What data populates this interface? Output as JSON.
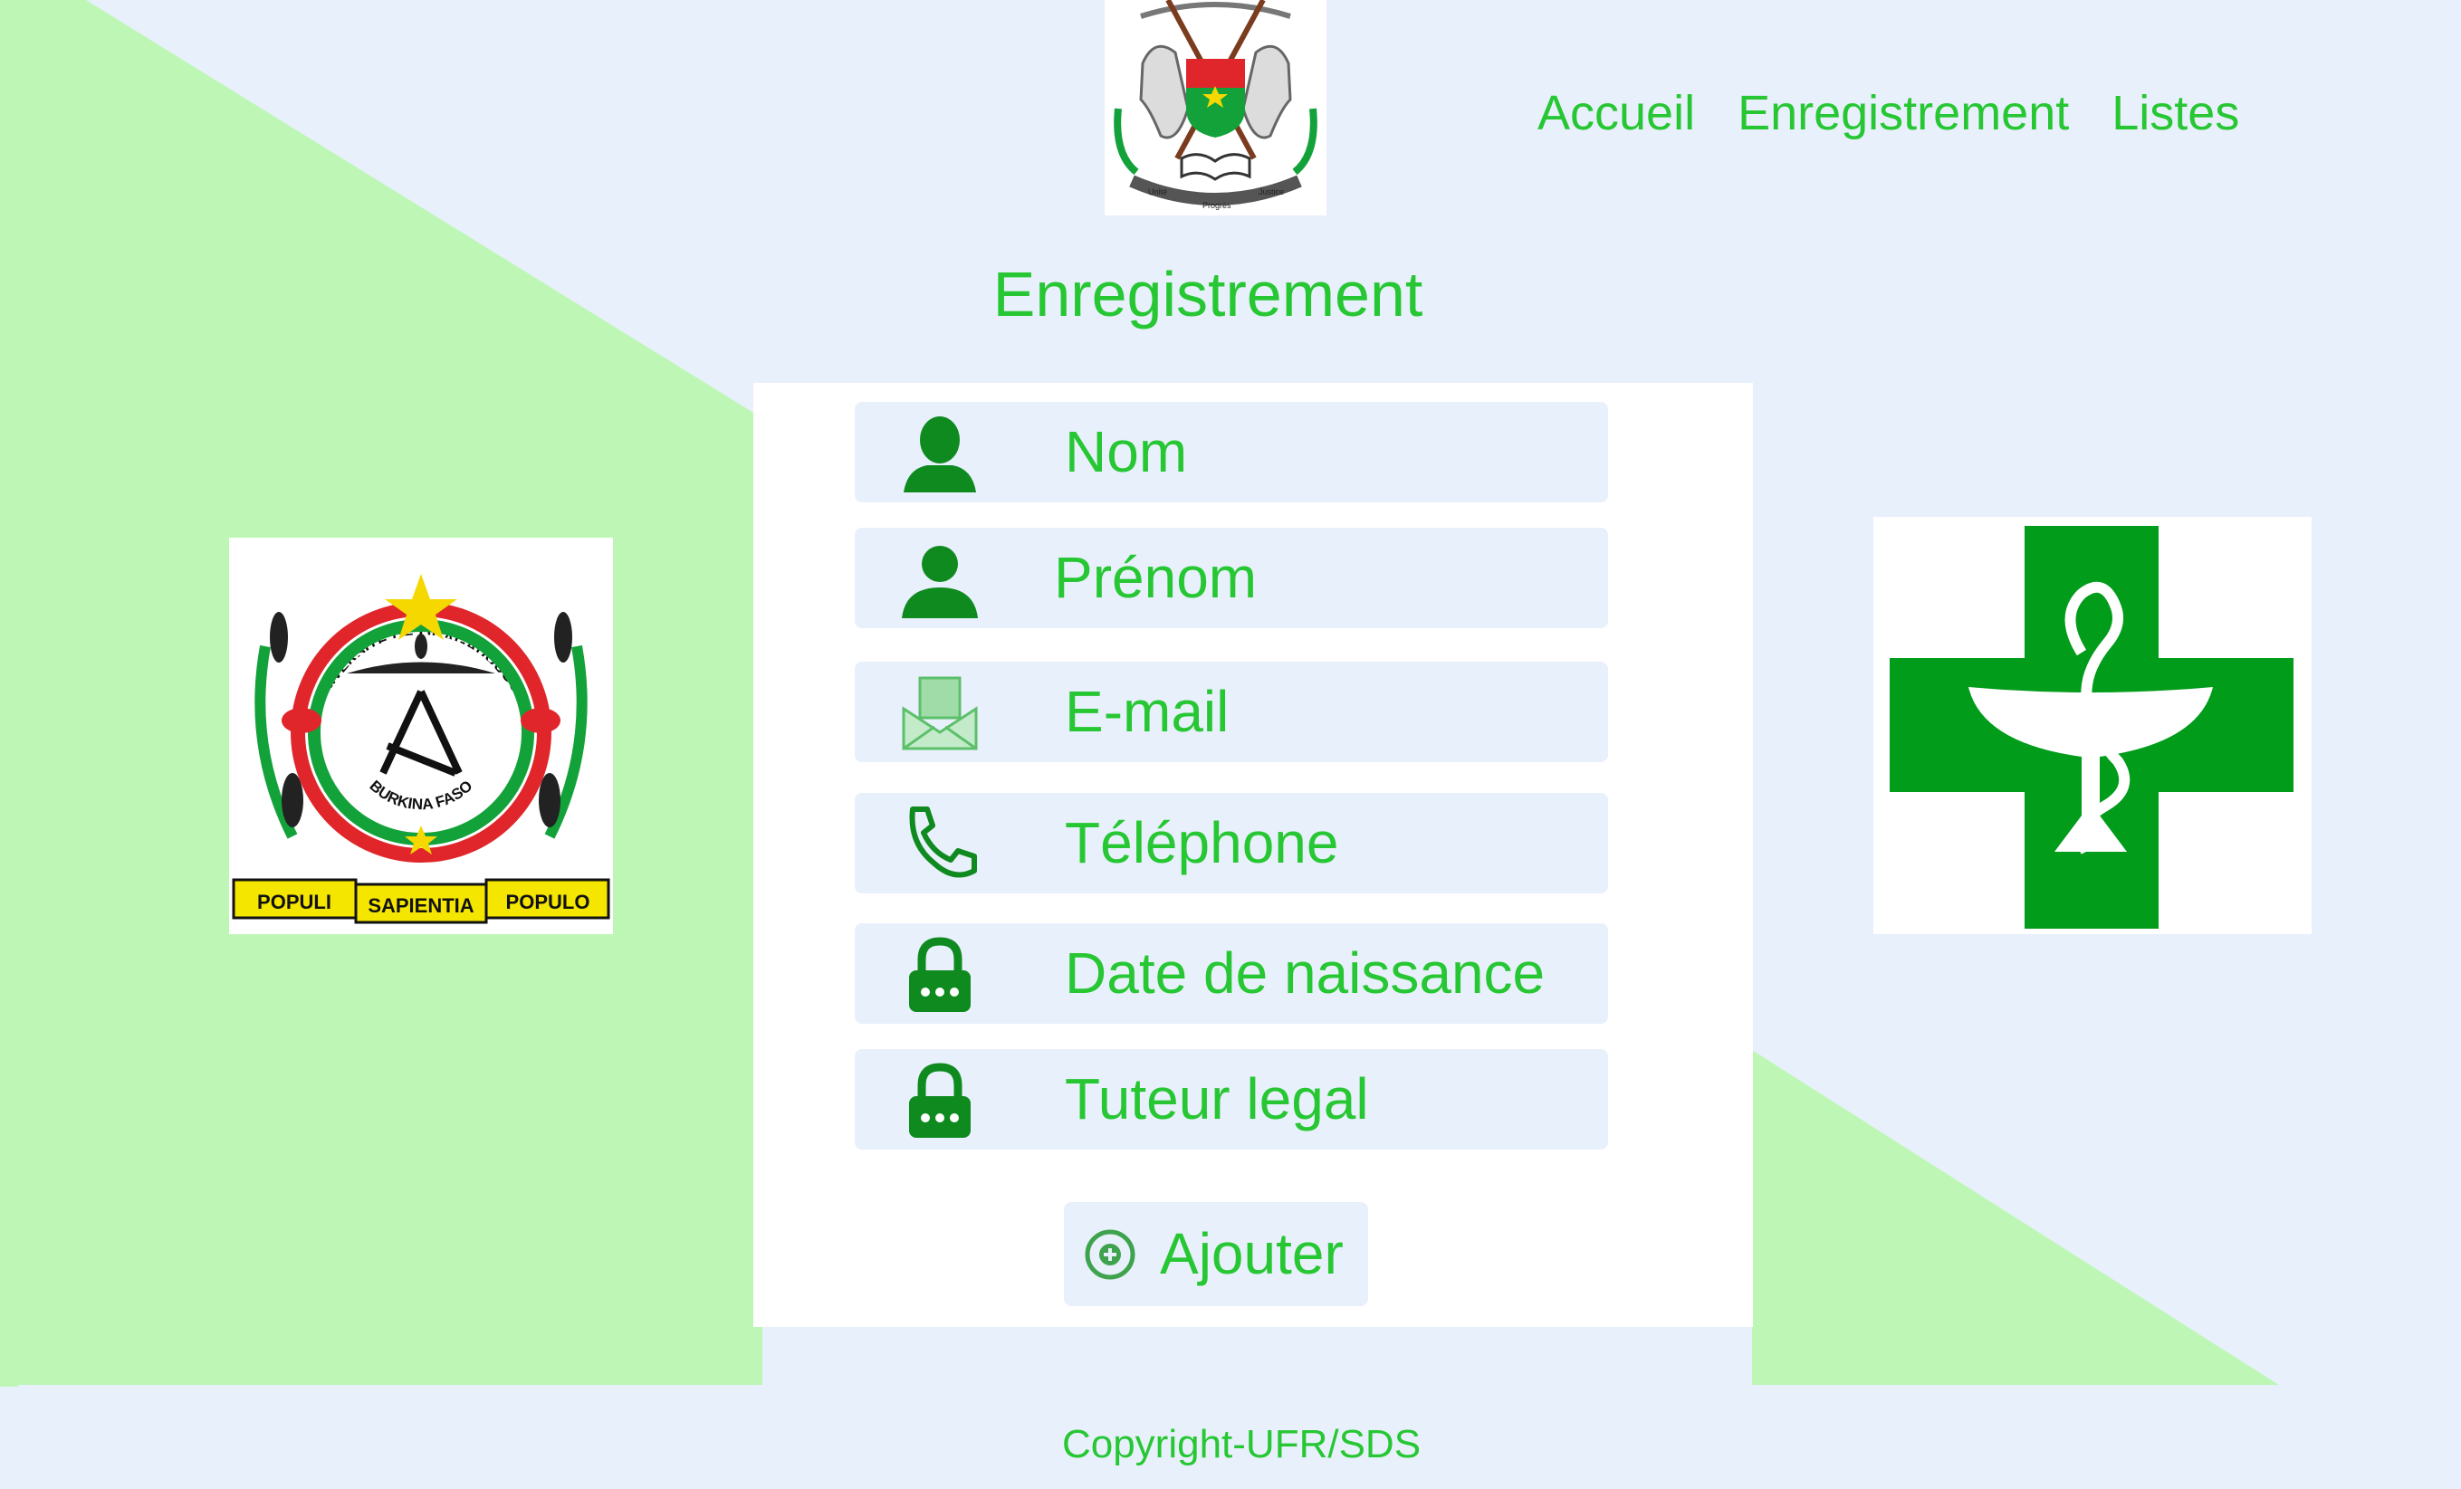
{
  "colors": {
    "background": "#e8f0fc",
    "accent_green": "#27c733",
    "light_green": "#bef7b5",
    "dark_green": "#0f8a1f",
    "pharmacy_green": "#009c1a",
    "card": "#ffffff"
  },
  "emblems": {
    "top": {
      "icon": "burkina-coat-of-arms",
      "text_motto": [
        "Unité",
        "Progrès",
        "Justice"
      ]
    },
    "left": {
      "icon": "universite-ouagadougou-seal",
      "text_top": "UNIVERSITE DE OUAGADOUGOU",
      "text_center": "BURKINA FASO",
      "ribbon": [
        "POPULI",
        "SAPIENTIA",
        "POPULO"
      ]
    },
    "right": {
      "icon": "pharmacy-cross-logo"
    }
  },
  "nav": {
    "items": [
      {
        "label": "Accueil"
      },
      {
        "label": "Enregistrement"
      },
      {
        "label": "Listes"
      }
    ]
  },
  "page": {
    "title": "Enregistrement"
  },
  "form": {
    "fields": [
      {
        "icon": "user-icon",
        "label": "Nom"
      },
      {
        "icon": "person-icon",
        "label": "Prénom"
      },
      {
        "icon": "envelope-icon",
        "label": "E-mail"
      },
      {
        "icon": "phone-icon",
        "label": "Téléphone"
      },
      {
        "icon": "lock-icon",
        "label": "Date de naissance"
      },
      {
        "icon": "lock-icon",
        "label": "Tuteur legal"
      }
    ],
    "submit": {
      "icon": "plus-circle-icon",
      "label": "Ajouter"
    }
  },
  "footer": {
    "text": "Copyright-UFR/SDS"
  }
}
